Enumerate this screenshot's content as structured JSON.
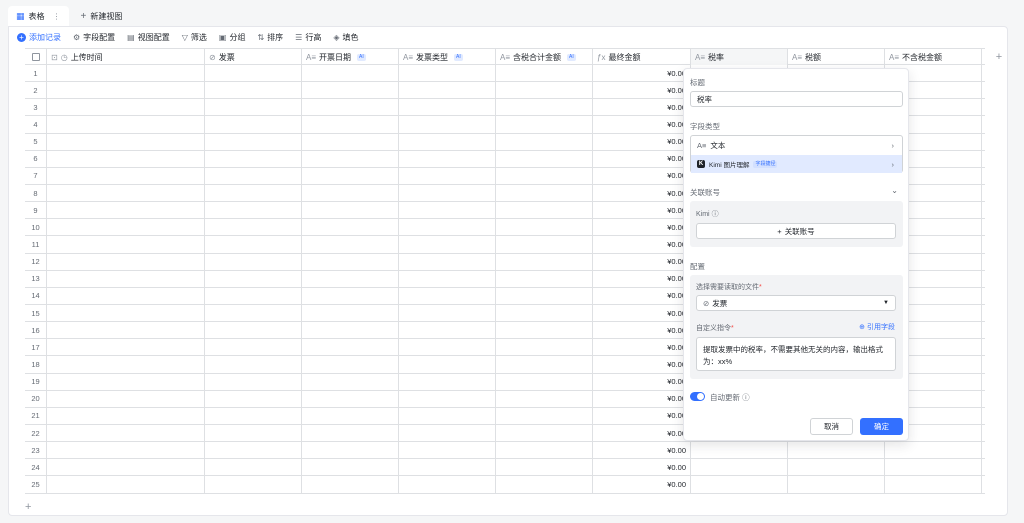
{
  "tabs": [
    {
      "label": "表格",
      "active": true
    },
    {
      "label": "新建视图",
      "active": false
    }
  ],
  "tab_more_icon": "more-vertical-icon",
  "toolbar": {
    "add_record": "添加记录",
    "field_config": "字段配置",
    "view_config": "视图配置",
    "filter": "筛选",
    "group": "分组",
    "sort": "排序",
    "row_height": "行高",
    "fill_color": "填色"
  },
  "columns": [
    {
      "label": "上传时间",
      "icon": "clock-icon",
      "ai": false
    },
    {
      "label": "发票",
      "icon": "attachment-icon",
      "ai": false
    },
    {
      "label": "开票日期",
      "icon": "text-icon",
      "ai": true
    },
    {
      "label": "发票类型",
      "icon": "text-icon",
      "ai": true
    },
    {
      "label": "含税合计金额",
      "icon": "text-icon",
      "ai": true
    },
    {
      "label": "最终金额",
      "icon": "formula-icon",
      "ai": false
    },
    {
      "label": "税率",
      "icon": "text-icon",
      "ai": false
    },
    {
      "label": "税额",
      "icon": "text-icon",
      "ai": false
    },
    {
      "label": "不含税金额",
      "icon": "text-icon",
      "ai": false
    }
  ],
  "ai_badge": "AI",
  "rows": [
    {
      "n": "1",
      "amount": "¥0.00"
    },
    {
      "n": "2",
      "amount": "¥0.00"
    },
    {
      "n": "3",
      "amount": "¥0.00"
    },
    {
      "n": "4",
      "amount": "¥0.00"
    },
    {
      "n": "5",
      "amount": "¥0.00"
    },
    {
      "n": "6",
      "amount": "¥0.00"
    },
    {
      "n": "7",
      "amount": "¥0.00"
    },
    {
      "n": "8",
      "amount": "¥0.00"
    },
    {
      "n": "9",
      "amount": "¥0.00"
    },
    {
      "n": "10",
      "amount": "¥0.00"
    },
    {
      "n": "11",
      "amount": "¥0.00"
    },
    {
      "n": "12",
      "amount": "¥0.00"
    },
    {
      "n": "13",
      "amount": "¥0.00"
    },
    {
      "n": "14",
      "amount": "¥0.00"
    },
    {
      "n": "15",
      "amount": "¥0.00"
    },
    {
      "n": "16",
      "amount": "¥0.00"
    },
    {
      "n": "17",
      "amount": "¥0.00"
    },
    {
      "n": "18",
      "amount": "¥0.00"
    },
    {
      "n": "19",
      "amount": "¥0.00"
    },
    {
      "n": "20",
      "amount": "¥0.00"
    },
    {
      "n": "21",
      "amount": "¥0.00"
    },
    {
      "n": "22",
      "amount": "¥0.00"
    },
    {
      "n": "23",
      "amount": "¥0.00"
    },
    {
      "n": "24",
      "amount": "¥0.00"
    },
    {
      "n": "25",
      "amount": "¥0.00"
    }
  ],
  "panel": {
    "title_label": "标题",
    "title_value": "税率",
    "field_type_label": "字段类型",
    "type_text": "文本",
    "type_kimi": "Kimi 图片理解",
    "type_kimi_tag": "字段捷径",
    "linked_account_label": "关联账号",
    "kimi_label": "Kimi",
    "link_account_button": "关联账号",
    "config_label": "配置",
    "file_select_label": "选择需要读取的文件",
    "file_select_value": "发票",
    "custom_prompt_label": "自定义指令",
    "reference_field": "引用字段",
    "prompt_text": "提取发票中的税率，不需要其他无关的内容，输出格式为：xx%",
    "auto_update_label": "自动更新",
    "auto_update_on": true,
    "cancel": "取消",
    "confirm": "确定"
  },
  "colors": {
    "accent": "#3370ff",
    "border": "#dee0e3"
  }
}
